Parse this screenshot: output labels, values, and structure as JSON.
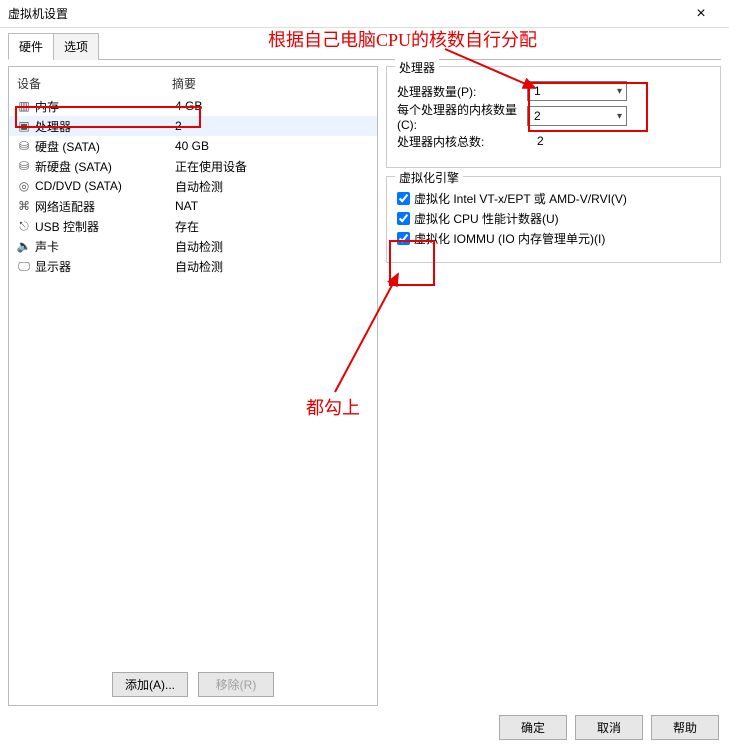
{
  "window": {
    "title": "虚拟机设置"
  },
  "tabs": {
    "hardware": "硬件",
    "options": "选项"
  },
  "list": {
    "header_device": "设备",
    "header_summary": "摘要",
    "items": [
      {
        "icon": "memory-icon",
        "name": "内存",
        "summary": "4 GB"
      },
      {
        "icon": "cpu-icon",
        "name": "处理器",
        "summary": "2"
      },
      {
        "icon": "hdd-icon",
        "name": "硬盘 (SATA)",
        "summary": "40 GB"
      },
      {
        "icon": "hdd-icon",
        "name": "新硬盘 (SATA)",
        "summary": "正在使用设备"
      },
      {
        "icon": "disc-icon",
        "name": "CD/DVD (SATA)",
        "summary": "自动检测"
      },
      {
        "icon": "net-icon",
        "name": "网络适配器",
        "summary": "NAT"
      },
      {
        "icon": "usb-icon",
        "name": "USB 控制器",
        "summary": "存在"
      },
      {
        "icon": "sound-icon",
        "name": "声卡",
        "summary": "自动检测"
      },
      {
        "icon": "display-icon",
        "name": "显示器",
        "summary": "自动检测"
      }
    ]
  },
  "buttons": {
    "add": "添加(A)...",
    "remove": "移除(R)"
  },
  "proc": {
    "group": "处理器",
    "count_label": "处理器数量(P):",
    "count_value": "1",
    "cores_label": "每个处理器的内核数量(C):",
    "cores_value": "2",
    "total_label": "处理器内核总数:",
    "total_value": "2"
  },
  "virt": {
    "group": "虚拟化引擎",
    "vt": "虚拟化 Intel VT-x/EPT 或 AMD-V/RVI(V)",
    "perf": "虚拟化 CPU 性能计数器(U)",
    "iommu": "虚拟化 IOMMU (IO 内存管理单元)(I)"
  },
  "footer": {
    "ok": "确定",
    "cancel": "取消",
    "help": "帮助"
  },
  "annotations": {
    "top": "根据自己电脑CPU的核数自行分配",
    "bottom": "都勾上"
  },
  "colors": {
    "highlight": "#e60000"
  }
}
